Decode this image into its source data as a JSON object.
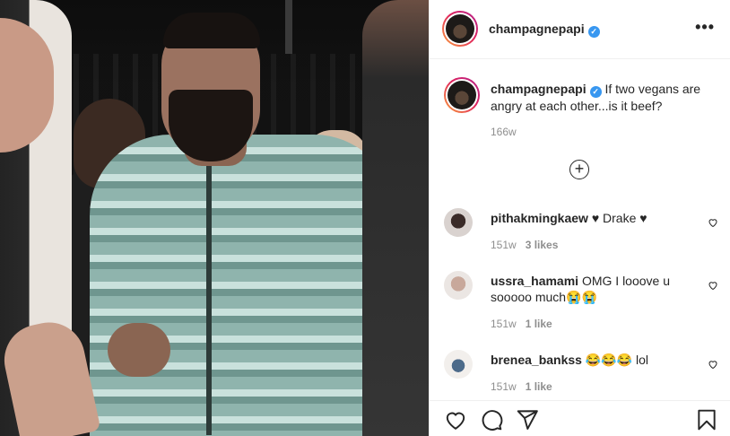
{
  "post": {
    "username": "champagnepapi",
    "verified_mark": "✓",
    "more_label": "•••",
    "caption_username": "champagnepapi",
    "caption_text": "If two vegans are angry at each other...is it beef?",
    "age": "166w",
    "load_more_label": "+"
  },
  "comments": [
    {
      "username": "pithakmingkaew",
      "text": "♥ Drake ♥",
      "age": "151w",
      "likes": "3 likes"
    },
    {
      "username": "ussra_hamami",
      "text": "OMG I looove u sooooo much😭😭",
      "age": "151w",
      "likes": "1 like"
    },
    {
      "username": "brenea_bankss",
      "text": "😂😂😂 lol",
      "age": "151w",
      "likes": "1 like"
    }
  ],
  "icons": {
    "like": "heart-icon",
    "comment": "comment-icon",
    "share": "paper-plane-icon",
    "save": "bookmark-icon",
    "more": "more-options-icon",
    "comment_like": "heart-outline-icon",
    "load_more": "plus-circle-icon"
  },
  "colors": {
    "verified": "#3897f0",
    "text": "#262626",
    "muted": "#8e8e8e",
    "border": "#efefef",
    "story_ring_start": "#f9a13b",
    "story_ring_end": "#b1228d"
  }
}
